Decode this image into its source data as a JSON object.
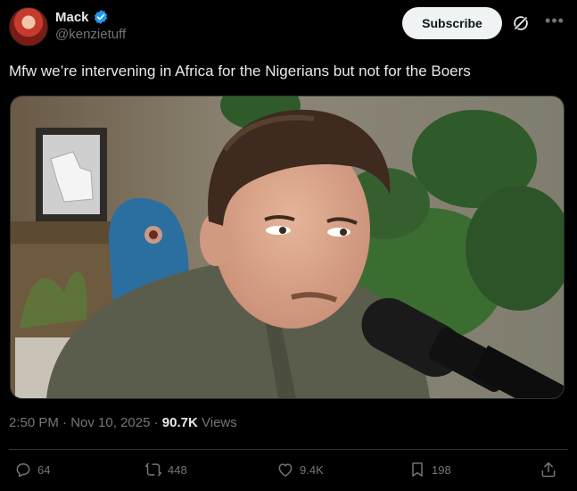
{
  "author": {
    "name": "Mack",
    "handle": "@kenzietuff"
  },
  "subscribe_label": "Subscribe",
  "tweet": {
    "text": "Mfw we’re intervening in Africa for the Nigerians but not for the Boers"
  },
  "meta": {
    "time": "2:50 PM",
    "sep1": "·",
    "date": "Nov 10, 2025",
    "sep2": "·",
    "views_count": "90.7K",
    "views_label": "Views"
  },
  "actions": {
    "replies": "64",
    "reposts": "448",
    "likes": "9.4K",
    "bookmarks": "198"
  },
  "colors": {
    "background": "#000000",
    "text": "#e7e9ea",
    "muted": "#71767b",
    "verified": "#1d9bf0"
  }
}
